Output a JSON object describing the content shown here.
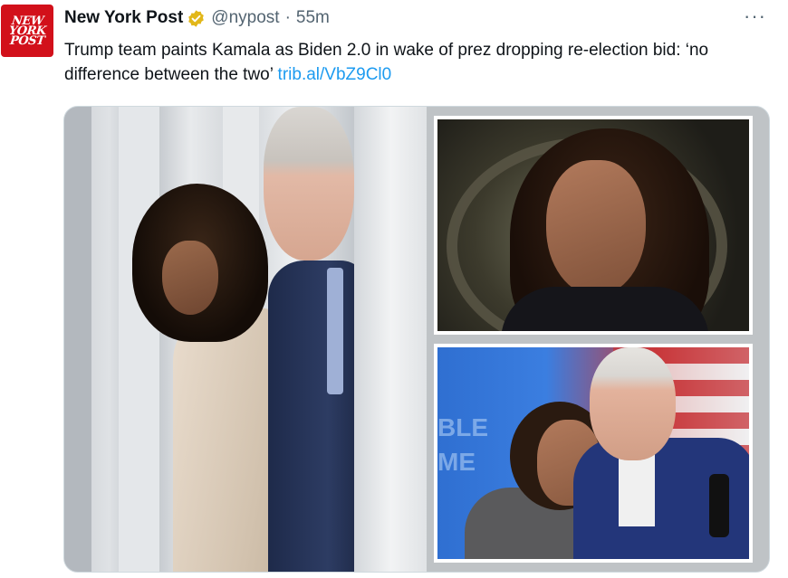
{
  "author": {
    "logo_lines": [
      "NEW",
      "YORK",
      "POST"
    ],
    "name": "New York Post",
    "handle": "@nypost",
    "separator": "·",
    "time": "55m",
    "verified_color": "#e2b719"
  },
  "tweet": {
    "text": "Trump team paints Kamala as Biden 2.0 in wake of prez dropping re-election bid: ‘no difference between the two’",
    "link": "trib.al/VbZ9Cl0"
  },
  "more_icon": "more-horizontal-icon",
  "colors": {
    "link": "#1d9bf0",
    "logo_bg": "#d2101a",
    "muted": "#536471"
  }
}
